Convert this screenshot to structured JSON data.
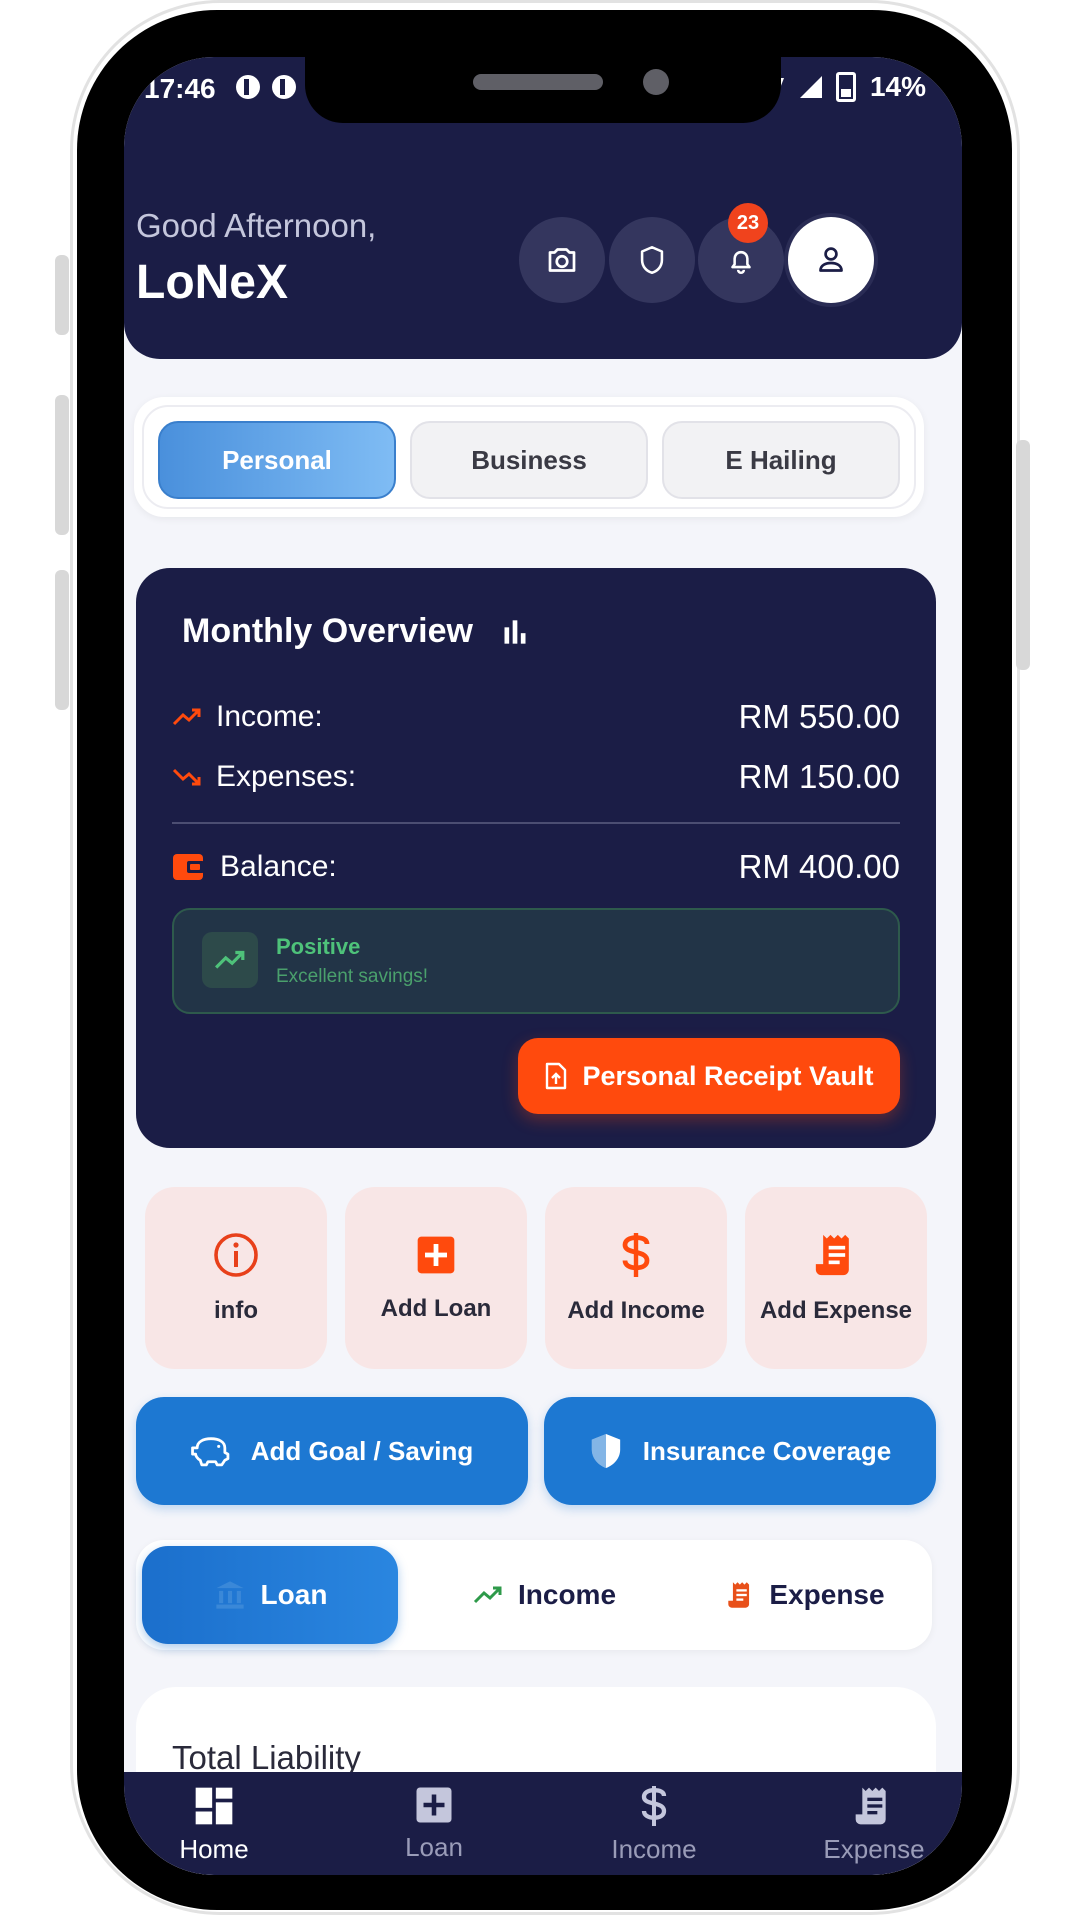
{
  "status_bar": {
    "time": "17:46",
    "battery": "14%"
  },
  "header": {
    "greeting": "Good Afternoon,",
    "username": "LoNeX",
    "notification_count": "23"
  },
  "segment": {
    "options": [
      "Personal",
      "Business",
      "E Hailing"
    ],
    "selected": "Personal"
  },
  "overview": {
    "title": "Monthly Overview",
    "income_label": "Income:",
    "income_value": "RM 550.00",
    "expenses_label": "Expenses:",
    "expenses_value": "RM 150.00",
    "balance_label": "Balance:",
    "balance_value": "RM 400.00",
    "status_title": "Positive",
    "status_sub": "Excellent savings!",
    "vault_label": "Personal Receipt Vault"
  },
  "quick_actions": [
    "info",
    "Add Loan",
    "Add Income",
    "Add Expense"
  ],
  "action_buttons": {
    "goal": "Add Goal / Saving",
    "insurance": "Insurance Coverage"
  },
  "tabs": [
    "Loan",
    "Income",
    "Expense"
  ],
  "liability": {
    "title": "Total Liability"
  },
  "bottom_nav": [
    "Home",
    "Loan",
    "Income",
    "Expense"
  ],
  "colors": {
    "navy": "#1b1d46",
    "accent_orange": "#ff4a0d",
    "accent_blue": "#1d78d2",
    "positive_green": "#4ec27a"
  }
}
